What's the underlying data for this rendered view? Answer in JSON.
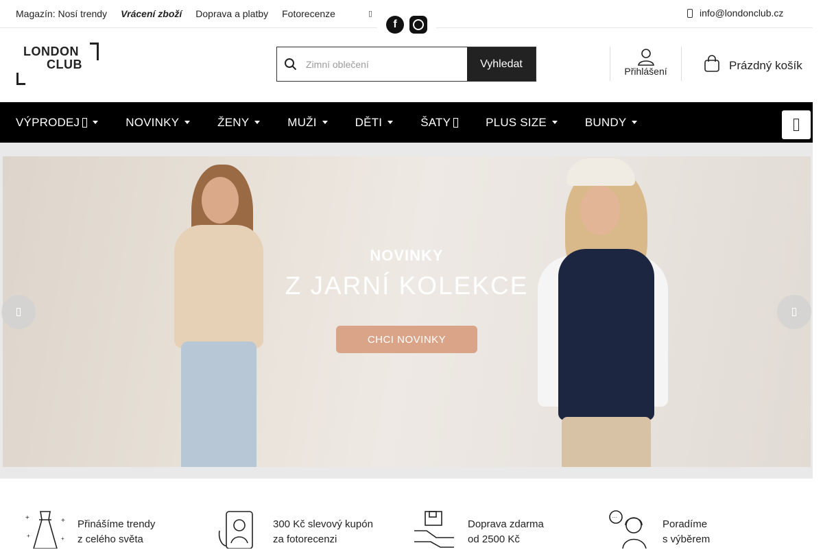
{
  "topbar": {
    "links": [
      {
        "label": "Magazín: Nosí trendy",
        "bold": false
      },
      {
        "label": "Vrácení zboží",
        "bold": true
      },
      {
        "label": "Doprava a platby",
        "bold": false
      },
      {
        "label": "Fotorecenze",
        "bold": false
      }
    ],
    "email": "info@londonclub.cz",
    "social": [
      "facebook-icon",
      "instagram-icon"
    ]
  },
  "header": {
    "logo_line1": "LONDON",
    "logo_line2": "CLUB",
    "search_placeholder": "Zimní oblečení",
    "search_button": "Vyhledat",
    "login_label": "Přihlášení",
    "cart_label": "Prázdný košík"
  },
  "nav": {
    "items": [
      {
        "label": "VÝPRODEJ",
        "suffix": "square"
      },
      {
        "label": "NOVINKY",
        "suffix": "caret"
      },
      {
        "label": "ŽENY",
        "suffix": "caret"
      },
      {
        "label": "MUŽI",
        "suffix": "caret"
      },
      {
        "label": "DĚTI",
        "suffix": "caret"
      },
      {
        "label": "ŠATY",
        "suffix": "square"
      },
      {
        "label": "PLUS SIZE",
        "suffix": "caret"
      },
      {
        "label": "BUNDY",
        "suffix": "caret"
      }
    ]
  },
  "hero": {
    "title": "NOVINKY",
    "subtitle": "Z JARNÍ KOLEKCE",
    "cta": "CHCI NOVINKY",
    "colors": {
      "cta": "#d9a487"
    }
  },
  "features": [
    {
      "line1": "Přinášíme trendy",
      "line2": "z celého světa",
      "icon": "dress-icon"
    },
    {
      "line1": "300 Kč slevový kupón",
      "line2": "za fotorecenzi",
      "icon": "phone-photo-icon"
    },
    {
      "line1": "Doprava zdarma",
      "line2": "od 2500 Kč",
      "icon": "delivery-icon"
    },
    {
      "line1": "Poradíme",
      "line2": "s výběrem",
      "icon": "support-icon"
    }
  ]
}
